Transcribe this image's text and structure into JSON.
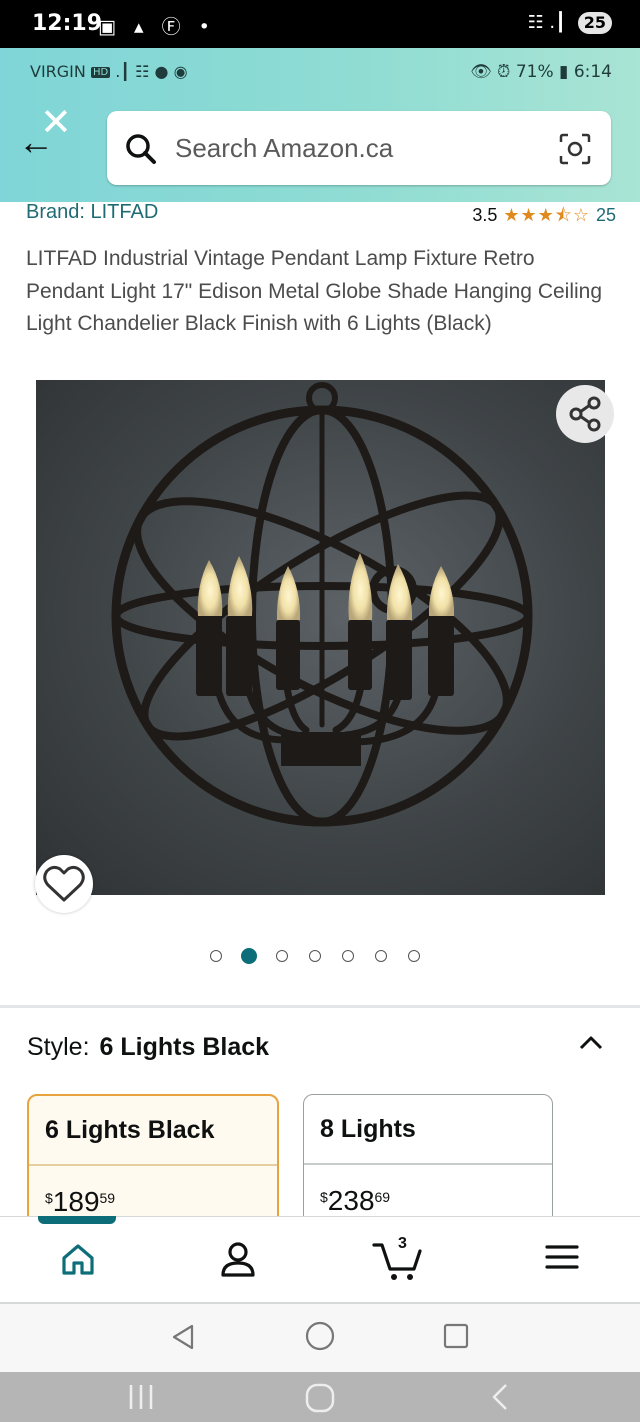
{
  "outer_status": {
    "time": "12:19",
    "icons_left": "▣ ▴ Ⓕ •",
    "signal": "☷ .┃",
    "notif_count": "25"
  },
  "inner_status": {
    "carrier": "VIRGIN",
    "hd": "HD",
    "icons": ".┃ ☷ ● ◉",
    "battery": "71%",
    "time": "6:14"
  },
  "search": {
    "placeholder": "Search Amazon.ca"
  },
  "product": {
    "brand": "Brand: LITFAD",
    "rating_value": "3.5",
    "stars": "★★★⯪☆",
    "rating_count": "25",
    "title": "LITFAD Industrial Vintage Pendant Lamp Fixture Retro Pendant Light 17\" Edison Metal Globe Shade Hanging Ceiling Light Chandelier Black Finish with 6 Lights (Black)"
  },
  "gallery": {
    "image_count": 7,
    "active_index": 1
  },
  "style": {
    "label": "Style:",
    "selected": "6 Lights Black",
    "options": [
      {
        "name": "6 Lights Black",
        "currency": "$",
        "whole": "189",
        "cents": "59",
        "selected": true
      },
      {
        "name": "8 Lights",
        "currency": "$",
        "whole": "238",
        "cents": "69",
        "selected": false
      }
    ]
  },
  "bottom_nav": {
    "items": [
      "home-icon",
      "account-icon",
      "cart-icon",
      "menu-icon"
    ],
    "cart_count": "3",
    "active": "home"
  },
  "colors": {
    "accent": "#0d6e7a",
    "header": "#8fdcd3",
    "star": "#e08a1e",
    "selected_border": "#e6a33e"
  }
}
